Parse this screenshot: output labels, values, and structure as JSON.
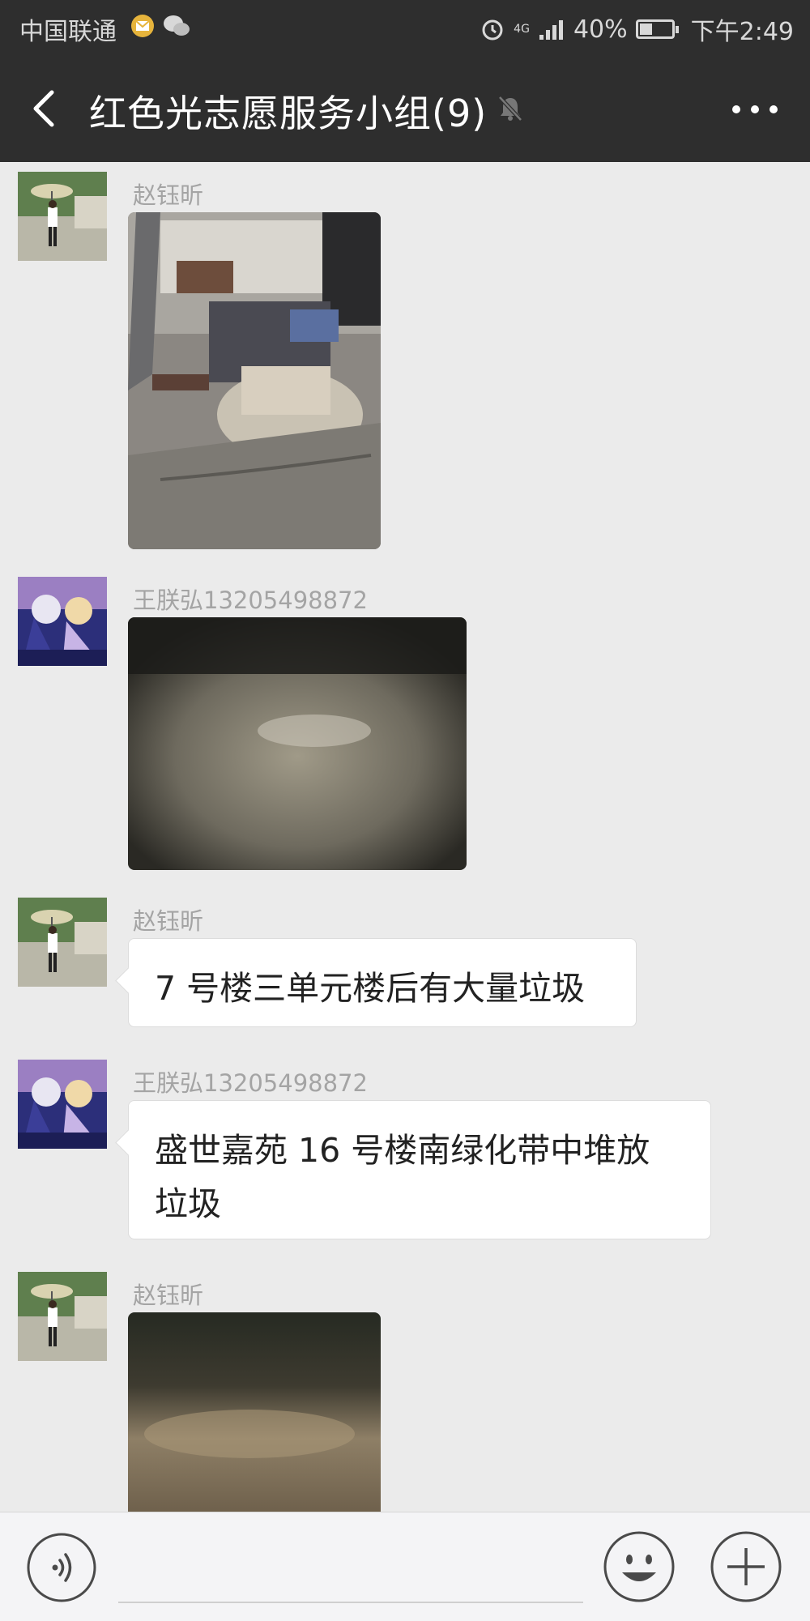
{
  "status_bar": {
    "carrier": "中国联通",
    "battery": "40%",
    "battery_level": 0.4,
    "time": "下午2:49",
    "network": "4G"
  },
  "header": {
    "title": "红色光志愿服务小组(9)"
  },
  "messages": [
    {
      "sender": "赵钰昕",
      "type": "image"
    },
    {
      "sender": "王朕弘13205498872",
      "type": "image"
    },
    {
      "sender": "赵钰昕",
      "type": "text",
      "text": "7 号楼三单元楼后有大量垃圾"
    },
    {
      "sender": "王朕弘13205498872",
      "type": "text",
      "text_line1": "盛世嘉苑 16 号楼南绿化带中堆放",
      "text_line2": "垃圾"
    },
    {
      "sender": "赵钰昕",
      "type": "image"
    }
  ],
  "colors": {
    "bar_bg": "#2e2e2e",
    "chat_bg": "#ebebeb",
    "bubble_bg": "#ffffff",
    "sender_text": "#a4a4a4"
  },
  "icons": [
    "back-arrow-icon",
    "mute-bell-icon",
    "more-dots-icon",
    "voice-icon",
    "emoji-icon",
    "plus-icon",
    "alarm-icon",
    "signal-icon",
    "battery-icon"
  ]
}
